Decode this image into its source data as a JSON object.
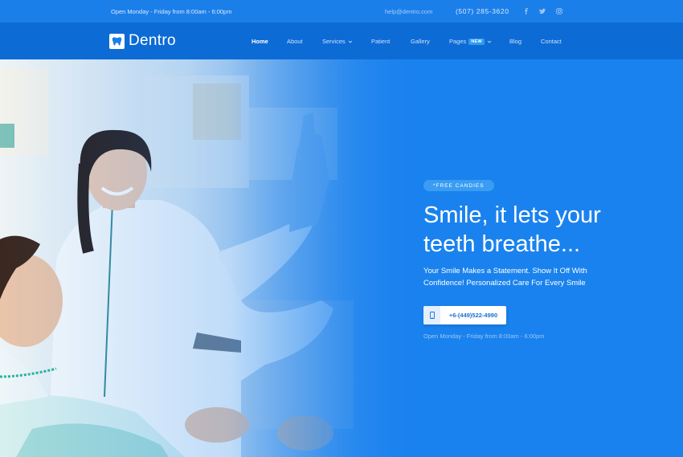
{
  "topbar": {
    "hours": "Open Monday - Friday from 8:00am - 6:00pm",
    "email": "help@dentro.com",
    "phone": "(507) 285-3620",
    "social": [
      "facebook-icon",
      "twitter-icon",
      "instagram-icon"
    ]
  },
  "nav": {
    "logo_text": "Dentro",
    "items": {
      "home": "Home",
      "about": "About",
      "services": "Services",
      "patient": "Patient",
      "gallery": "Gallery",
      "pages": "Pages",
      "pages_badge": "NEW",
      "blog": "Blog",
      "contact": "Contact"
    }
  },
  "hero": {
    "badge": "*FREE CANDIES",
    "headline_line1": "Smile, it lets your",
    "headline_line2": "teeth breathe...",
    "subtext_line1": "Your Smile Makes a Statement. Show It Off With",
    "subtext_line2": "Confidence! Personalized Care For Every Smile",
    "phone": "+6-(449)522-4990",
    "hours": "Open Monday - Friday from 8:00am - 6:00pm"
  },
  "colors": {
    "primary": "#1a82ee",
    "nav": "#0d6bd6",
    "topbar": "#1b7fea",
    "badge": "#3a9df3",
    "white": "#ffffff"
  }
}
